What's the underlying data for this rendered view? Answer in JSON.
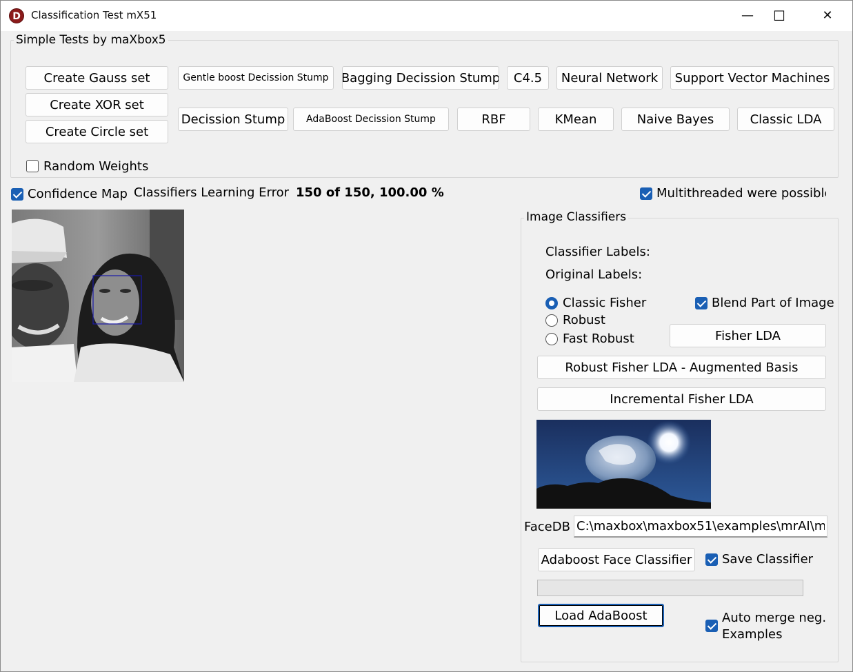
{
  "window": {
    "title": "Classification Test mX51",
    "app_icon_letter": "D",
    "minimize": "—",
    "maximize": "☐",
    "close": "✕"
  },
  "simple_tests": {
    "legend": "Simple Tests by maXbox5",
    "buttons": {
      "create_gauss": "Create Gauss set",
      "create_xor": "Create XOR set",
      "create_circle": "Create Circle set",
      "gentle_boost": "Gentle boost Decission Stump",
      "bagging": "Bagging Decission Stump",
      "c45": "C4.5",
      "neural_network": "Neural Network",
      "svm": "Support Vector Machines",
      "decission_stump": "Decission Stump",
      "adaboost_stump": "AdaBoost Decission Stump",
      "rbf": "RBF",
      "kmean": "KMean",
      "naive_bayes": "Naive Bayes",
      "classic_lda": "Classic LDA"
    },
    "random_weights": {
      "label": "Random Weights",
      "checked": false
    }
  },
  "status": {
    "confidence_map": {
      "label": "Confidence Map",
      "checked": true
    },
    "learning_error_label": "Classifiers Learning Error",
    "learning_error_value": "150 of 150, 100.00 %",
    "multithreaded": {
      "label": "Multithreaded were possible",
      "checked": true
    }
  },
  "image_classifiers": {
    "legend": "Image Classifiers",
    "classifier_labels": "Classifier Labels:",
    "original_labels": "Original Labels:",
    "radios": {
      "classic_fisher": {
        "label": "Classic Fisher",
        "selected": true
      },
      "robust": {
        "label": "Robust",
        "selected": false
      },
      "fast_robust": {
        "label": "Fast Robust",
        "selected": false
      }
    },
    "blend_part": {
      "label": "Blend Part of Image",
      "checked": true
    },
    "fisher_lda": "Fisher LDA",
    "robust_fisher_lda": "Robust Fisher LDA - Augmented Basis",
    "incremental_fisher_lda": "Incremental Fisher LDA",
    "facedb_label": "FaceDB",
    "facedb_value": "C:\\maxbox\\maxbox51\\examples\\mrAI\\m",
    "adaboost_face": "Adaboost Face Classifier",
    "save_classifier": {
      "label": "Save Classifier",
      "checked": true
    },
    "progress": 0,
    "load_adaboost": "Load AdaBoost",
    "auto_merge": {
      "label_line1": "Auto merge neg.",
      "label_line2": "Examples",
      "checked": true
    }
  },
  "colors": {
    "accent": "#1a5fb4",
    "window_bg": "#f0f0f0",
    "app_icon": "#8b1a1a"
  }
}
